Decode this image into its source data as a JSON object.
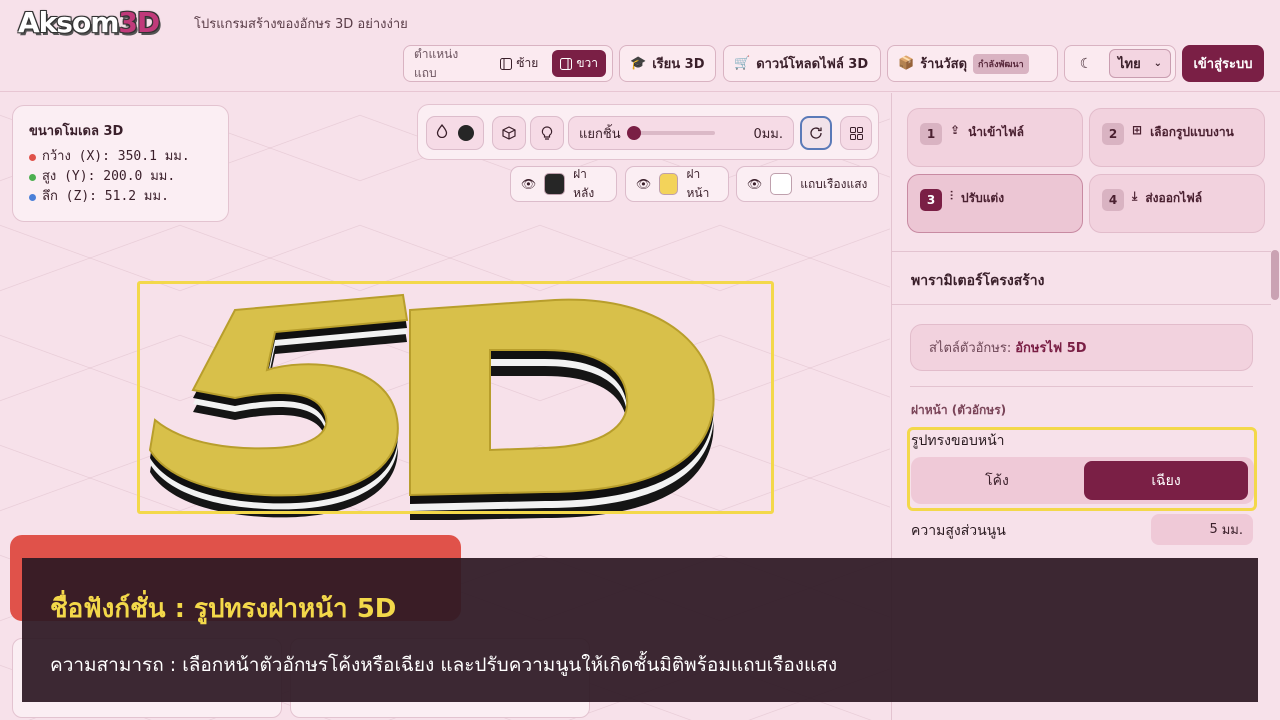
{
  "header": {
    "logo_main": "Aksom",
    "logo_3d": "3D",
    "tagline": "โปรแกรมสร้างของอักษร 3D อย่างง่าย",
    "position_label": "ตำแหน่งแถบ",
    "position_left": "ซ้าย",
    "position_right": "ขวา",
    "learn_label": "เรียน 3D",
    "download_label": "ดาวน์โหลดไฟล์ 3D",
    "shop_label": "ร้านวัสดุ",
    "shop_badge": "กำลังพัฒนา",
    "language": "ไทย",
    "login_label": "เข้าสู่ระบบ"
  },
  "dimensions": {
    "title_prefix": "ขนาดโมเดล",
    "title_suffix": "3D",
    "width": "กว้าง (X): 350.1 มม.",
    "height": "สูง (Y): 200.0 มม.",
    "depth": "ลึก (Z): 51.2 มม.",
    "colors": {
      "x": "#e0524a",
      "y": "#4caf50",
      "z": "#4a7fd8"
    }
  },
  "toolbar": {
    "separate_label": "แยกชิ้น",
    "separate_value": "0มม."
  },
  "layers": [
    {
      "label": "ฝาหลัง",
      "color": "#262626"
    },
    {
      "label": "ฝาหน้า",
      "color": "#f3d35a"
    },
    {
      "label": "แถบเรืองแสง",
      "color": "#ffffff"
    }
  ],
  "canvas": {
    "text": "5D",
    "face_color": "#d8c04a",
    "side_color": "#141414",
    "glow_color": "#f4f4f4"
  },
  "steps": [
    {
      "num": "1",
      "label": "นำเข้าไฟล์"
    },
    {
      "num": "2",
      "label": "เลือกรูปแบบงาน"
    },
    {
      "num": "3",
      "label": "ปรับแต่ง"
    },
    {
      "num": "4",
      "label": "ส่งออกไฟล์"
    }
  ],
  "panel": {
    "title": "พารามิเตอร์โครงสร้าง",
    "font_style_label": "สไตล์ตัวอักษร:",
    "font_style_value": "อักษรไฟ 5D",
    "section": "ฝาหน้า (ตัวอักษร)",
    "shape_label": "รูปทรงขอบหน้า",
    "shape_curved": "โค้ง",
    "shape_beveled": "เฉียง",
    "depth_label": "ความสูงส่วนนูน",
    "depth_value": "5",
    "depth_unit": "มม."
  },
  "caption": {
    "title": "ชื่อฟังก์ชั่น : รูปทรงฝาหน้า 5D",
    "description": "ความสามารถ : เลือกหน้าตัวอักษรโค้งหรือเฉียง และปรับความนูนให้เกิดชั้นมิติพร้อมแถบเรืองแสง"
  }
}
